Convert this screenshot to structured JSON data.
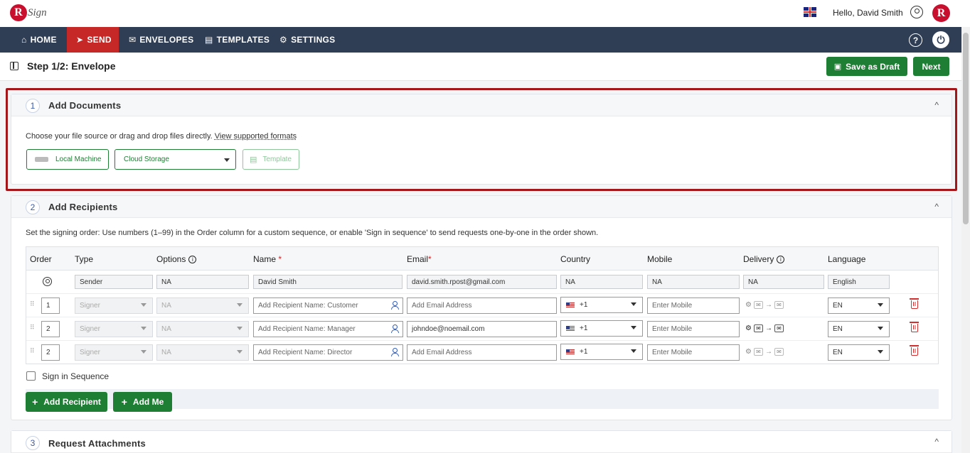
{
  "app": {
    "logo_letter": "R",
    "logo_text": "Sign",
    "greeting": "Hello, David Smith",
    "brand_letter": "R"
  },
  "nav": {
    "items": [
      {
        "label": "HOME",
        "icon": "home-icon"
      },
      {
        "label": "SEND",
        "icon": "send-icon",
        "active": true
      },
      {
        "label": "ENVELOPES",
        "icon": "envelope-icon"
      },
      {
        "label": "TEMPLATES",
        "icon": "template-icon"
      },
      {
        "label": "SETTINGS",
        "icon": "gear-icon"
      }
    ],
    "help_glyph": "?",
    "power_glyph": "⏻"
  },
  "step": {
    "title": "Step 1/2: Envelope",
    "save_draft_label": "Save as Draft",
    "next_label": "Next"
  },
  "documents": {
    "number": "1",
    "title": "Add Documents",
    "description": "Choose your file source or drag and drop files directly. ",
    "formats_link": "View supported formats",
    "local_label": "Local Machine",
    "cloud_label": "Cloud Storage",
    "template_label": "Template"
  },
  "recipients": {
    "number": "2",
    "title": "Add Recipients",
    "description": "Set the signing order: Use numbers (1–99) in the Order column for a custom sequence, or enable 'Sign in sequence' to send requests one-by-one in the order shown.",
    "headers": {
      "order": "Order",
      "type": "Type",
      "options": "Options",
      "name": "Name",
      "email": "Email",
      "country": "Country",
      "mobile": "Mobile",
      "delivery": "Delivery",
      "language": "Language",
      "required_mark": "*",
      "info_glyph": "i"
    },
    "sender": {
      "type": "Sender",
      "options": "NA",
      "name": "David Smith",
      "email": "david.smith.rpost@gmail.com",
      "country": "NA",
      "mobile": "NA",
      "delivery": "NA",
      "language": "English"
    },
    "rows": [
      {
        "order": "1",
        "type": "Signer",
        "options": "NA",
        "name_placeholder": "Add Recipient Name: Customer",
        "email_placeholder": "Add Email Address",
        "email": "",
        "country_code": "+1",
        "mobile_placeholder": "Enter Mobile",
        "language": "EN"
      },
      {
        "order": "2",
        "type": "Signer",
        "options": "NA",
        "name_placeholder": "Add Recipient Name: Manager",
        "email_placeholder": "Add Email Address",
        "email": "johndoe@noemail.com",
        "country_code": "+1",
        "mobile_placeholder": "Enter Mobile",
        "language": "EN"
      },
      {
        "order": "2",
        "type": "Signer",
        "options": "NA",
        "name_placeholder": "Add Recipient Name: Director",
        "email_placeholder": "Add Email Address",
        "email": "",
        "country_code": "+1",
        "mobile_placeholder": "Enter Mobile",
        "language": "EN"
      }
    ],
    "sign_in_sequence_label": "Sign in Sequence",
    "add_recipient_label": "Add Recipient",
    "add_me_label": "Add Me",
    "plus_glyph": "+"
  },
  "attachments": {
    "number": "3",
    "title": "Request Attachments"
  },
  "glyphs": {
    "chevron_up": "^",
    "arrow_right": "→",
    "gear": "⚙",
    "envelope": "✉",
    "grip": "⠿"
  },
  "colors": {
    "nav_bg": "#2f3e55",
    "active_red": "#c62828",
    "green": "#1e7e34",
    "highlight": "#a4161a"
  }
}
